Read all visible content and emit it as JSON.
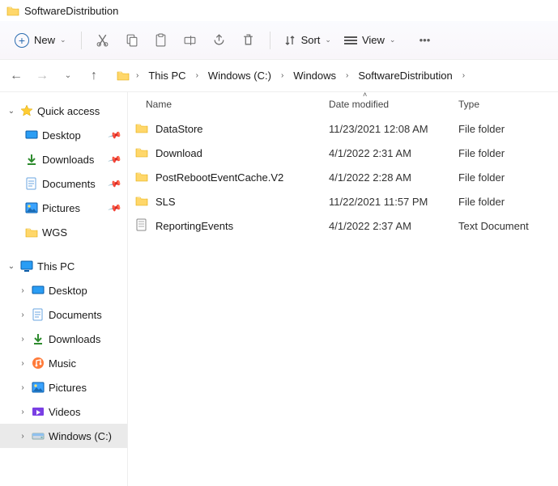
{
  "window_title": "SoftwareDistribution",
  "toolbar": {
    "new_label": "New",
    "sort_label": "Sort",
    "view_label": "View"
  },
  "breadcrumb": [
    "This PC",
    "Windows (C:)",
    "Windows",
    "SoftwareDistribution"
  ],
  "sidebar": {
    "quick_access": "Quick access",
    "qa_items": [
      {
        "label": "Desktop",
        "pinned": true
      },
      {
        "label": "Downloads",
        "pinned": true
      },
      {
        "label": "Documents",
        "pinned": true
      },
      {
        "label": "Pictures",
        "pinned": true
      },
      {
        "label": "WGS",
        "pinned": false
      }
    ],
    "this_pc": "This PC",
    "pc_items": [
      {
        "label": "Desktop"
      },
      {
        "label": "Documents"
      },
      {
        "label": "Downloads"
      },
      {
        "label": "Music"
      },
      {
        "label": "Pictures"
      },
      {
        "label": "Videos"
      },
      {
        "label": "Windows (C:)"
      }
    ]
  },
  "columns": {
    "name": "Name",
    "date": "Date modified",
    "type": "Type"
  },
  "items": [
    {
      "kind": "folder",
      "name": "DataStore",
      "modified": "11/23/2021 12:08 AM",
      "type": "File folder"
    },
    {
      "kind": "folder",
      "name": "Download",
      "modified": "4/1/2022 2:31 AM",
      "type": "File folder"
    },
    {
      "kind": "folder",
      "name": "PostRebootEventCache.V2",
      "modified": "4/1/2022 2:28 AM",
      "type": "File folder"
    },
    {
      "kind": "folder",
      "name": "SLS",
      "modified": "11/22/2021 11:57 PM",
      "type": "File folder"
    },
    {
      "kind": "text",
      "name": "ReportingEvents",
      "modified": "4/1/2022 2:37 AM",
      "type": "Text Document"
    }
  ]
}
